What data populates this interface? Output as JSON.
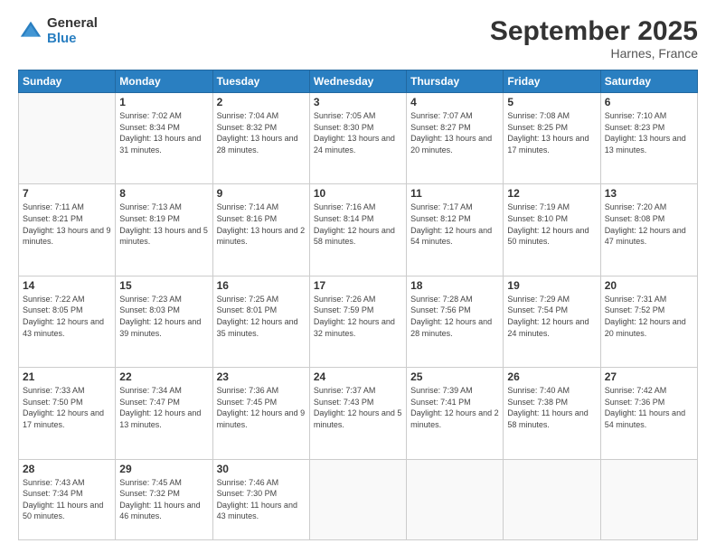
{
  "logo": {
    "general": "General",
    "blue": "Blue"
  },
  "title": "September 2025",
  "subtitle": "Harnes, France",
  "days_header": [
    "Sunday",
    "Monday",
    "Tuesday",
    "Wednesday",
    "Thursday",
    "Friday",
    "Saturday"
  ],
  "weeks": [
    [
      {
        "day": "",
        "info": ""
      },
      {
        "day": "1",
        "info": "Sunrise: 7:02 AM\nSunset: 8:34 PM\nDaylight: 13 hours\nand 31 minutes."
      },
      {
        "day": "2",
        "info": "Sunrise: 7:04 AM\nSunset: 8:32 PM\nDaylight: 13 hours\nand 28 minutes."
      },
      {
        "day": "3",
        "info": "Sunrise: 7:05 AM\nSunset: 8:30 PM\nDaylight: 13 hours\nand 24 minutes."
      },
      {
        "day": "4",
        "info": "Sunrise: 7:07 AM\nSunset: 8:27 PM\nDaylight: 13 hours\nand 20 minutes."
      },
      {
        "day": "5",
        "info": "Sunrise: 7:08 AM\nSunset: 8:25 PM\nDaylight: 13 hours\nand 17 minutes."
      },
      {
        "day": "6",
        "info": "Sunrise: 7:10 AM\nSunset: 8:23 PM\nDaylight: 13 hours\nand 13 minutes."
      }
    ],
    [
      {
        "day": "7",
        "info": "Sunrise: 7:11 AM\nSunset: 8:21 PM\nDaylight: 13 hours\nand 9 minutes."
      },
      {
        "day": "8",
        "info": "Sunrise: 7:13 AM\nSunset: 8:19 PM\nDaylight: 13 hours\nand 5 minutes."
      },
      {
        "day": "9",
        "info": "Sunrise: 7:14 AM\nSunset: 8:16 PM\nDaylight: 13 hours\nand 2 minutes."
      },
      {
        "day": "10",
        "info": "Sunrise: 7:16 AM\nSunset: 8:14 PM\nDaylight: 12 hours\nand 58 minutes."
      },
      {
        "day": "11",
        "info": "Sunrise: 7:17 AM\nSunset: 8:12 PM\nDaylight: 12 hours\nand 54 minutes."
      },
      {
        "day": "12",
        "info": "Sunrise: 7:19 AM\nSunset: 8:10 PM\nDaylight: 12 hours\nand 50 minutes."
      },
      {
        "day": "13",
        "info": "Sunrise: 7:20 AM\nSunset: 8:08 PM\nDaylight: 12 hours\nand 47 minutes."
      }
    ],
    [
      {
        "day": "14",
        "info": "Sunrise: 7:22 AM\nSunset: 8:05 PM\nDaylight: 12 hours\nand 43 minutes."
      },
      {
        "day": "15",
        "info": "Sunrise: 7:23 AM\nSunset: 8:03 PM\nDaylight: 12 hours\nand 39 minutes."
      },
      {
        "day": "16",
        "info": "Sunrise: 7:25 AM\nSunset: 8:01 PM\nDaylight: 12 hours\nand 35 minutes."
      },
      {
        "day": "17",
        "info": "Sunrise: 7:26 AM\nSunset: 7:59 PM\nDaylight: 12 hours\nand 32 minutes."
      },
      {
        "day": "18",
        "info": "Sunrise: 7:28 AM\nSunset: 7:56 PM\nDaylight: 12 hours\nand 28 minutes."
      },
      {
        "day": "19",
        "info": "Sunrise: 7:29 AM\nSunset: 7:54 PM\nDaylight: 12 hours\nand 24 minutes."
      },
      {
        "day": "20",
        "info": "Sunrise: 7:31 AM\nSunset: 7:52 PM\nDaylight: 12 hours\nand 20 minutes."
      }
    ],
    [
      {
        "day": "21",
        "info": "Sunrise: 7:33 AM\nSunset: 7:50 PM\nDaylight: 12 hours\nand 17 minutes."
      },
      {
        "day": "22",
        "info": "Sunrise: 7:34 AM\nSunset: 7:47 PM\nDaylight: 12 hours\nand 13 minutes."
      },
      {
        "day": "23",
        "info": "Sunrise: 7:36 AM\nSunset: 7:45 PM\nDaylight: 12 hours\nand 9 minutes."
      },
      {
        "day": "24",
        "info": "Sunrise: 7:37 AM\nSunset: 7:43 PM\nDaylight: 12 hours\nand 5 minutes."
      },
      {
        "day": "25",
        "info": "Sunrise: 7:39 AM\nSunset: 7:41 PM\nDaylight: 12 hours\nand 2 minutes."
      },
      {
        "day": "26",
        "info": "Sunrise: 7:40 AM\nSunset: 7:38 PM\nDaylight: 11 hours\nand 58 minutes."
      },
      {
        "day": "27",
        "info": "Sunrise: 7:42 AM\nSunset: 7:36 PM\nDaylight: 11 hours\nand 54 minutes."
      }
    ],
    [
      {
        "day": "28",
        "info": "Sunrise: 7:43 AM\nSunset: 7:34 PM\nDaylight: 11 hours\nand 50 minutes."
      },
      {
        "day": "29",
        "info": "Sunrise: 7:45 AM\nSunset: 7:32 PM\nDaylight: 11 hours\nand 46 minutes."
      },
      {
        "day": "30",
        "info": "Sunrise: 7:46 AM\nSunset: 7:30 PM\nDaylight: 11 hours\nand 43 minutes."
      },
      {
        "day": "",
        "info": ""
      },
      {
        "day": "",
        "info": ""
      },
      {
        "day": "",
        "info": ""
      },
      {
        "day": "",
        "info": ""
      }
    ]
  ]
}
